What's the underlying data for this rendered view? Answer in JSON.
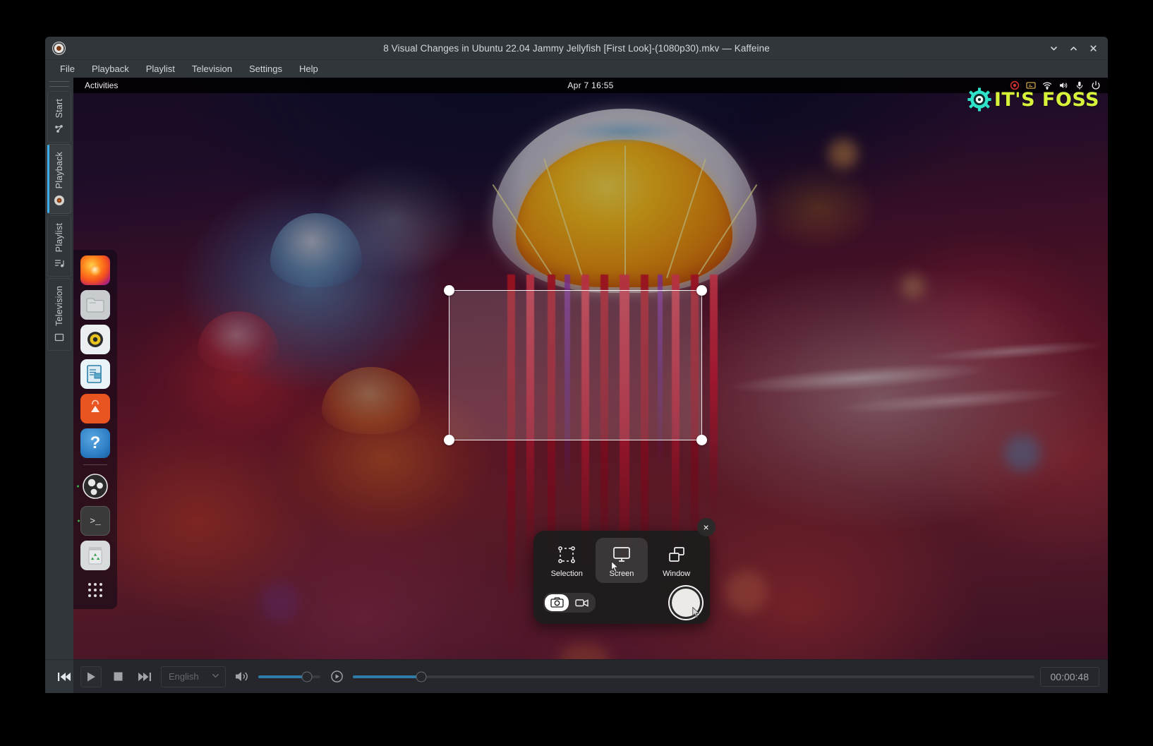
{
  "window": {
    "title": "8 Visual Changes in Ubuntu 22.04 Jammy Jellyfish [First Look]-(1080p30).mkv — Kaffeine",
    "app_icon": "kaffeine-icon",
    "controls": {
      "minimize": "minimize-icon",
      "maximize": "maximize-icon",
      "close": "close-icon"
    }
  },
  "menubar": {
    "items": [
      {
        "label": "File"
      },
      {
        "label": "Playback"
      },
      {
        "label": "Playlist"
      },
      {
        "label": "Television"
      },
      {
        "label": "Settings"
      },
      {
        "label": "Help"
      }
    ]
  },
  "tabrail": {
    "tabs": [
      {
        "label": "Start",
        "icon": "start-icon",
        "active": false
      },
      {
        "label": "Playback",
        "icon": "playback-icon",
        "active": true
      },
      {
        "label": "Playlist",
        "icon": "playlist-icon",
        "active": false
      },
      {
        "label": "Television",
        "icon": "television-icon",
        "active": false
      }
    ]
  },
  "gnome_topbar": {
    "activities": "Activities",
    "clock": "Apr 7  16:55",
    "tray_icons": [
      "screen-recording-icon",
      "screencast-icon",
      "wifi-icon",
      "volume-icon",
      "microphone-icon",
      "power-icon"
    ]
  },
  "watermark": {
    "text": "IT'S FOSS",
    "gear_color": "#2fe3c8",
    "text_color": "#d6f23a"
  },
  "dock": {
    "items": [
      {
        "name": "firefox",
        "label": "Firefox",
        "running": false
      },
      {
        "name": "files",
        "label": "Files",
        "running": false
      },
      {
        "name": "rhythmbox",
        "label": "Rhythmbox",
        "running": false
      },
      {
        "name": "libreoffice-writer",
        "label": "LibreOffice Writer",
        "running": false
      },
      {
        "name": "ubuntu-software",
        "label": "Ubuntu Software",
        "running": false
      },
      {
        "name": "help",
        "label": "Help",
        "running": false
      },
      {
        "name": "obs-studio",
        "label": "OBS Studio",
        "running": true
      },
      {
        "name": "terminal",
        "label": "Terminal",
        "running": true
      },
      {
        "name": "trash",
        "label": "Trash",
        "running": false
      },
      {
        "name": "show-applications",
        "label": "Show Applications",
        "running": false
      }
    ]
  },
  "screenshot_tool": {
    "modes": [
      {
        "label": "Selection",
        "icon": "selection-icon",
        "selected": false
      },
      {
        "label": "Screen",
        "icon": "screen-icon",
        "selected": true
      },
      {
        "label": "Window",
        "icon": "window-icon",
        "selected": false
      }
    ],
    "capture_types": [
      {
        "name": "screenshot",
        "icon": "camera-icon",
        "active": true
      },
      {
        "name": "screencast",
        "icon": "video-camera-icon",
        "active": false
      }
    ],
    "shutter": "shutter-button",
    "close": "×"
  },
  "selection": {
    "handles": [
      "top-left",
      "top-right",
      "bottom-left",
      "bottom-right"
    ]
  },
  "player_controls": {
    "previous": "skip-backward-icon",
    "play": "play-icon",
    "stop": "stop-icon",
    "next": "skip-forward-icon",
    "audio_track": "English",
    "audio_track_caret": "chevron-down-icon",
    "volume_icon": "volume-icon",
    "volume_percent": 78,
    "speed_icon": "playback-speed-icon",
    "seek_percent": 10,
    "time": "00:00:48"
  },
  "colors": {
    "window_bg": "#31363b",
    "accent": "#3daee9",
    "text": "#d3d7da",
    "ubuntu_orange": "#e95420"
  }
}
